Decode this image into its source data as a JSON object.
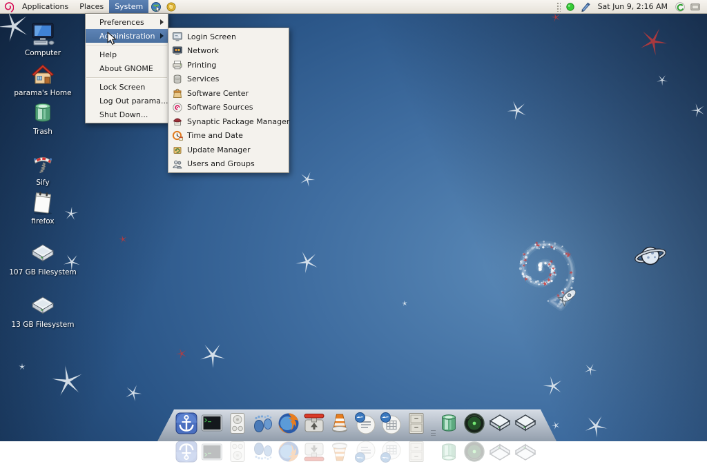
{
  "panel": {
    "logo": "debian-swirl",
    "menus": [
      {
        "id": "applications",
        "label": "Applications",
        "active": false
      },
      {
        "id": "places",
        "label": "Places",
        "active": false
      },
      {
        "id": "system",
        "label": "System",
        "active": true
      }
    ],
    "launchers": [
      {
        "id": "web-browser",
        "icon": "browser-globe"
      },
      {
        "id": "package-tool",
        "icon": "yellow-ball"
      }
    ],
    "tray_left": [
      {
        "id": "status-indicator",
        "icon": "green-dot"
      },
      {
        "id": "input-pen",
        "icon": "blue-pen"
      }
    ],
    "clock": "Sat Jun 9, 2:16 AM",
    "tray_right": [
      {
        "id": "update-notifier",
        "icon": "update-swirl"
      },
      {
        "id": "notification-tray",
        "icon": "gray-tray"
      }
    ]
  },
  "system_menu": {
    "items": [
      {
        "type": "item",
        "label": "Preferences",
        "submenu": true,
        "highlighted": false
      },
      {
        "type": "item",
        "label": "Administration",
        "submenu": true,
        "highlighted": true
      },
      {
        "type": "separator"
      },
      {
        "type": "item",
        "label": "Help"
      },
      {
        "type": "item",
        "label": "About GNOME"
      },
      {
        "type": "separator"
      },
      {
        "type": "item",
        "label": "Lock Screen"
      },
      {
        "type": "item",
        "label": "Log Out parama..."
      },
      {
        "type": "item",
        "label": "Shut Down..."
      }
    ]
  },
  "admin_submenu": {
    "items": [
      {
        "label": "Login Screen",
        "icon": "login-screen"
      },
      {
        "label": "Network",
        "icon": "network"
      },
      {
        "label": "Printing",
        "icon": "printer"
      },
      {
        "label": "Services",
        "icon": "services"
      },
      {
        "label": "Software Center",
        "icon": "software-center"
      },
      {
        "label": "Software Sources",
        "icon": "software-sources"
      },
      {
        "label": "Synaptic Package Manager",
        "icon": "synaptic"
      },
      {
        "label": "Time and Date",
        "icon": "time-date"
      },
      {
        "label": "Update Manager",
        "icon": "update-manager"
      },
      {
        "label": "Users and Groups",
        "icon": "users-groups"
      }
    ]
  },
  "desktop_icons": [
    {
      "label": "Computer",
      "icon": "computer"
    },
    {
      "label": "parama's Home",
      "icon": "home"
    },
    {
      "label": "Trash",
      "icon": "trash"
    },
    {
      "label": "Sify",
      "icon": "sify"
    },
    {
      "label": "firefox",
      "icon": "notepad"
    },
    {
      "label": "107 GB Filesystem",
      "icon": "drive"
    },
    {
      "label": "13 GB Filesystem",
      "icon": "drive"
    }
  ],
  "dock": {
    "items": [
      "docky-anchor",
      "terminal",
      "speaker",
      "footprints",
      "firefox",
      "transmission",
      "vlc",
      "ooo-writer",
      "ooo-calc",
      "file-cabinet",
      "separator",
      "trash",
      "green-orb",
      "drive",
      "drive"
    ]
  },
  "colors": {
    "panel_bg": "#ece9e2",
    "menu_highlight": "#4f77ae",
    "desktop_center": "#5586b6",
    "desktop_edge": "#122c4e",
    "debian_red": "#d70751"
  }
}
